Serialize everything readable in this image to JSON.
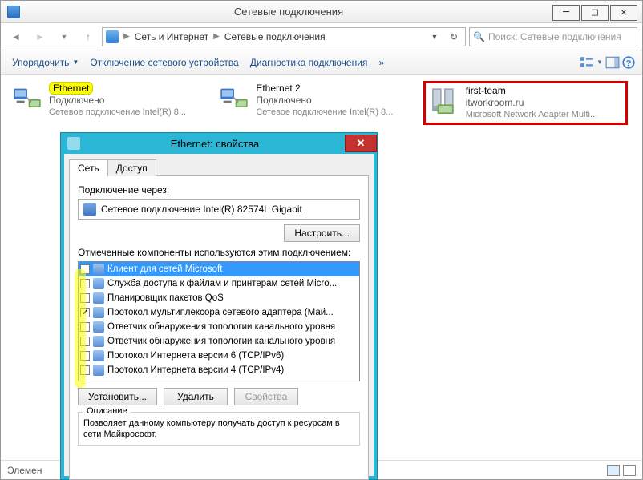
{
  "window": {
    "title": "Сетевые подключения",
    "breadcrumb": {
      "a": "Сеть и Интернет",
      "b": "Сетевые подключения"
    },
    "search_placeholder": "Поиск: Сетевые подключения",
    "cmd": {
      "organize": "Упорядочить",
      "disable": "Отключение сетевого устройства",
      "diag": "Диагностика подключения",
      "more": "»"
    },
    "status_prefix": "Элемен"
  },
  "connections": [
    {
      "name": "Ethernet",
      "status": "Подключено",
      "desc": "Сетевое подключение Intel(R) 8...",
      "highlight": true
    },
    {
      "name": "Ethernet 2",
      "status": "Подключено",
      "desc": "Сетевое подключение Intel(R) 8..."
    },
    {
      "name": "first-team",
      "status": "itworkroom.ru",
      "desc": "Microsoft Network Adapter Multi...",
      "team": true
    }
  ],
  "dialog": {
    "title": "Ethernet: свойства",
    "tab_net": "Сеть",
    "tab_access": "Доступ",
    "connect_via_label": "Подключение через:",
    "adapter": "Сетевое подключение Intel(R) 82574L Gigabit",
    "configure_btn": "Настроить...",
    "components_label": "Отмеченные компоненты используются этим подключением:",
    "install_btn": "Установить...",
    "remove_btn": "Удалить",
    "props_btn": "Свойства",
    "desc_label": "Описание",
    "desc_text": "Позволяет данному компьютеру получать доступ к ресурсам в сети Майкрософт.",
    "items": [
      {
        "checked": false,
        "label": "Клиент для сетей Microsoft",
        "selected": true
      },
      {
        "checked": false,
        "label": "Служба доступа к файлам и принтерам сетей Micro..."
      },
      {
        "checked": false,
        "label": "Планировщик пакетов QoS"
      },
      {
        "checked": true,
        "label": "Протокол мультиплексора сетевого адаптера (Май..."
      },
      {
        "checked": false,
        "label": "Ответчик обнаружения топологии канального уровня"
      },
      {
        "checked": false,
        "label": "Ответчик обнаружения топологии канального уровня"
      },
      {
        "checked": false,
        "label": "Протокол Интернета версии 6 (TCP/IPv6)"
      },
      {
        "checked": false,
        "label": "Протокол Интернета версии 4 (TCP/IPv4)"
      }
    ]
  }
}
